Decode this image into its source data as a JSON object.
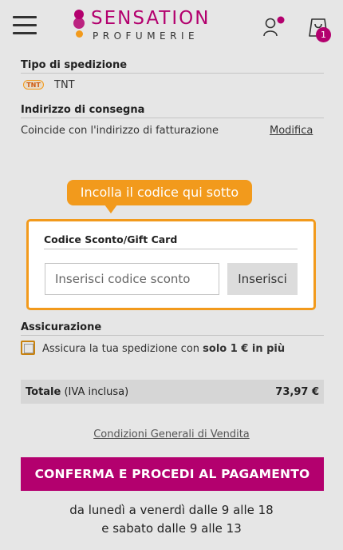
{
  "brand": {
    "name": "SENSATION",
    "subtitle": "PROFUMERIE",
    "primary_color": "#b3006e",
    "accent_color": "#f29a1c"
  },
  "header": {
    "cart_count": "1",
    "icons": [
      "menu-icon",
      "user-icon",
      "cart-icon"
    ]
  },
  "shipping": {
    "title": "Tipo di spedizione",
    "carrier_logo": "TNT",
    "carrier": "TNT"
  },
  "address": {
    "title": "Indirizzo di consegna",
    "text": "Coincide con l'indirizzo di fatturazione",
    "edit_link": "Modifica"
  },
  "coupon": {
    "tooltip": "Incolla il codice qui sotto",
    "title": "Codice Sconto/Gift Card",
    "placeholder": "Inserisci codice sconto",
    "value": "",
    "button": "Inserisci"
  },
  "insurance": {
    "title": "Assicurazione",
    "label_prefix": "Assicura la tua spedizione con ",
    "label_bold": "solo 1 € in più",
    "checked": false
  },
  "total": {
    "label": "Totale",
    "note": "(IVA inclusa)",
    "value": "73,97 €"
  },
  "terms_link": "Condizioni Generali di Vendita",
  "cta_button": "CONFERMA E PROCEDI AL PAGAMENTO",
  "hours": {
    "line1": "da lunedì a venerdì dalle 9 alle 18",
    "line2": "e sabato dalle 9 alle 13"
  }
}
